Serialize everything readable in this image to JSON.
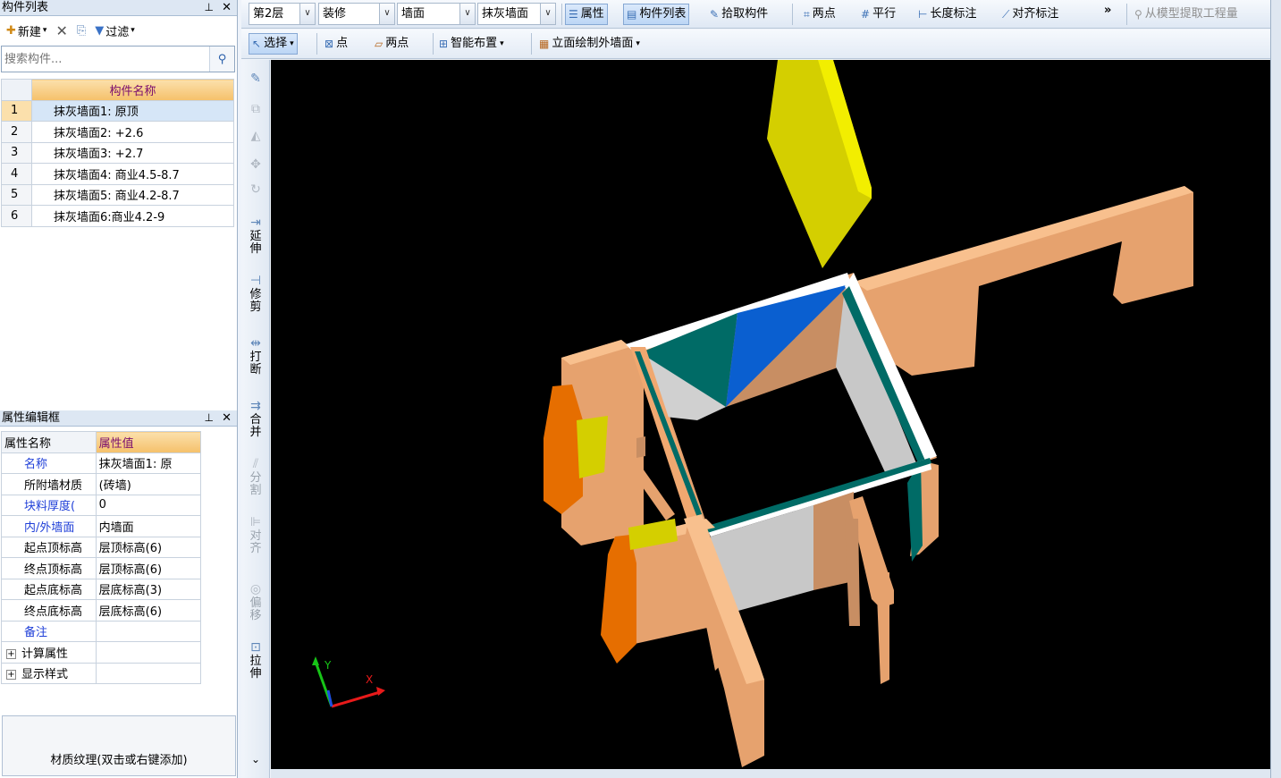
{
  "component_list": {
    "title": "构件列表",
    "new_label": "新建",
    "filter_label": "过滤",
    "search_placeholder": "搜索构件...",
    "column_header": "构件名称",
    "rows": [
      {
        "num": "1",
        "name": "抹灰墙面1: 原顶"
      },
      {
        "num": "2",
        "name": "抹灰墙面2: +2.6"
      },
      {
        "num": "3",
        "name": "抹灰墙面3: +2.7"
      },
      {
        "num": "4",
        "name": "抹灰墙面4: 商业4.5-8.7"
      },
      {
        "num": "5",
        "name": "抹灰墙面5: 商业4.2-8.7"
      },
      {
        "num": "6",
        "name": "抹灰墙面6:商业4.2-9"
      }
    ]
  },
  "property_editor": {
    "title": "属性编辑框",
    "col_name": "属性名称",
    "col_value": "属性值",
    "rows": [
      {
        "name": "名称",
        "value": "抹灰墙面1: 原",
        "blue": true
      },
      {
        "name": "所附墙材质",
        "value": "(砖墙)",
        "blue": false
      },
      {
        "name": "块料厚度(",
        "value": "0",
        "blue": true
      },
      {
        "name": "内/外墙面",
        "value": "内墙面",
        "blue": true
      },
      {
        "name": "起点顶标高",
        "value": "层顶标高(6)",
        "blue": false
      },
      {
        "name": "终点顶标高",
        "value": "层顶标高(6)",
        "blue": false
      },
      {
        "name": "起点底标高",
        "value": "层底标高(3)",
        "blue": false
      },
      {
        "name": "终点底标高",
        "value": "层底标高(6)",
        "blue": false
      },
      {
        "name": "备注",
        "value": "",
        "blue": true
      }
    ],
    "groups": [
      "计算属性",
      "显示样式"
    ]
  },
  "texture_label": "材质纹理(双击或右键添加)",
  "toolbar1": {
    "floor": "第2层",
    "category": "装修",
    "type": "墙面",
    "subtype": "抹灰墙面",
    "properties": "属性",
    "component_list": "构件列表",
    "pick": "拾取构件",
    "two_point": "两点",
    "parallel": "平行",
    "length_dim": "长度标注",
    "align_dim": "对齐标注",
    "more": "»",
    "extract": "从模型提取工程量"
  },
  "toolbar2": {
    "select": "选择",
    "point": "点",
    "two_point": "两点",
    "smart_layout": "智能布置",
    "elevation_draw": "立面绘制外墙面"
  },
  "vertical_tools": [
    "延伸",
    "修剪",
    "打断",
    "合并",
    "分割",
    "对齐",
    "偏移",
    "拉伸"
  ],
  "axes": {
    "x": "X",
    "y": "Y"
  },
  "colors": {
    "beam": "#e6a26e",
    "beam_top": "#f8c08e",
    "yellow": "#d4cf00",
    "teal": "#006b66",
    "blue": "#0a5fd0",
    "orange": "#e66e00"
  }
}
